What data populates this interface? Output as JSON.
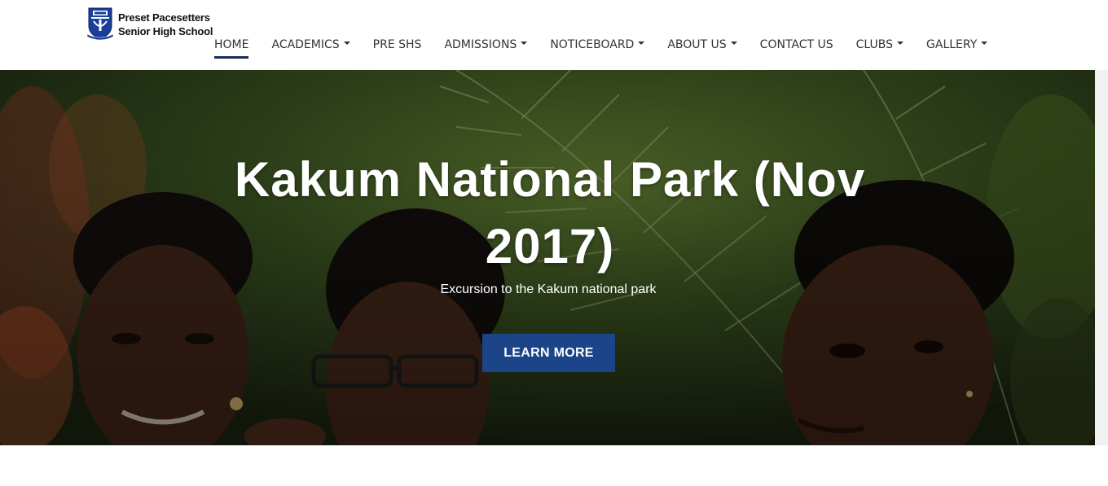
{
  "brand": {
    "line1": "Preset Pacesetters",
    "line2": "Senior High School",
    "crest_icon": "school-crest-icon"
  },
  "nav": {
    "items": [
      {
        "label": "HOME",
        "active": true,
        "dropdown": false
      },
      {
        "label": "ACADEMICS",
        "active": false,
        "dropdown": true
      },
      {
        "label": "PRE SHS",
        "active": false,
        "dropdown": false
      },
      {
        "label": "ADMISSIONS",
        "active": false,
        "dropdown": true
      },
      {
        "label": "NOTICEBOARD",
        "active": false,
        "dropdown": true
      },
      {
        "label": "ABOUT US",
        "active": false,
        "dropdown": true
      },
      {
        "label": "CONTACT US",
        "active": false,
        "dropdown": false
      },
      {
        "label": "CLUBS",
        "active": false,
        "dropdown": true
      },
      {
        "label": "GALLERY",
        "active": false,
        "dropdown": true
      }
    ]
  },
  "hero": {
    "title_line1": "Kakum National Park (Nov",
    "title_line2": "2017)",
    "subtitle": "Excursion to the Kakum national park",
    "button_label": "LEARN MORE",
    "button_color": "#1b4588"
  },
  "colors": {
    "active_underline": "#1b2d52",
    "nav_text": "#333333"
  }
}
